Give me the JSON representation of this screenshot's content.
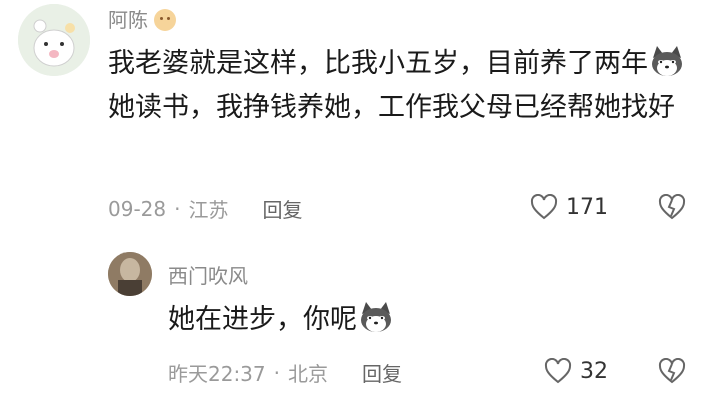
{
  "comment": {
    "username": "阿陈",
    "text_before_emoji": "我老婆就是这样，比我小五岁，目前养了两年",
    "text_after_emoji": "她读书，我挣钱养她，工作我父母已经帮她找好",
    "date": "09-28",
    "location": "江苏",
    "separator": "·",
    "reply_label": "回复",
    "likes": "171",
    "icons": [
      "heart-icon",
      "dislike-icon",
      "dog-emoji-icon",
      "smile-emoji-icon"
    ]
  },
  "reply": {
    "username": "西门吹风",
    "text": "她在进步，你呢",
    "time": "昨天22:37",
    "location": "北京",
    "separator": "·",
    "reply_label": "回复",
    "likes": "32"
  },
  "colors": {
    "meta_gray": "#9a9a9a",
    "text": "#1a1a1a",
    "username_gray": "#8a8a8a"
  }
}
